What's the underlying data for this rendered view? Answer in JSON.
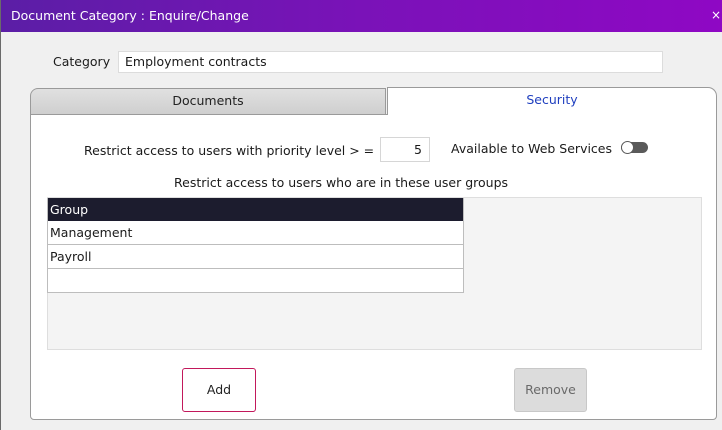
{
  "window": {
    "title": "Document Category : Enquire/Change",
    "close_glyph": "×"
  },
  "category": {
    "label": "Category",
    "value": "Employment contracts"
  },
  "tabs": [
    {
      "label": "Documents",
      "active": false
    },
    {
      "label": "Security",
      "active": true
    }
  ],
  "security": {
    "priority_label": "Restrict access to users with priority level > =",
    "priority_value": "5",
    "web_services_label": "Available to Web Services",
    "web_services_enabled": false,
    "groups_label": "Restrict access to users who are in these user groups",
    "groups_header": "Group",
    "groups": [
      "Management",
      "Payroll",
      ""
    ]
  },
  "buttons": {
    "add": "Add",
    "remove": "Remove",
    "remove_enabled": false
  },
  "colors": {
    "titlebar_start": "#5b1ea6",
    "titlebar_end": "#8f08c4",
    "active_tab_text": "#1f3fbf",
    "add_border": "#c2185b"
  }
}
